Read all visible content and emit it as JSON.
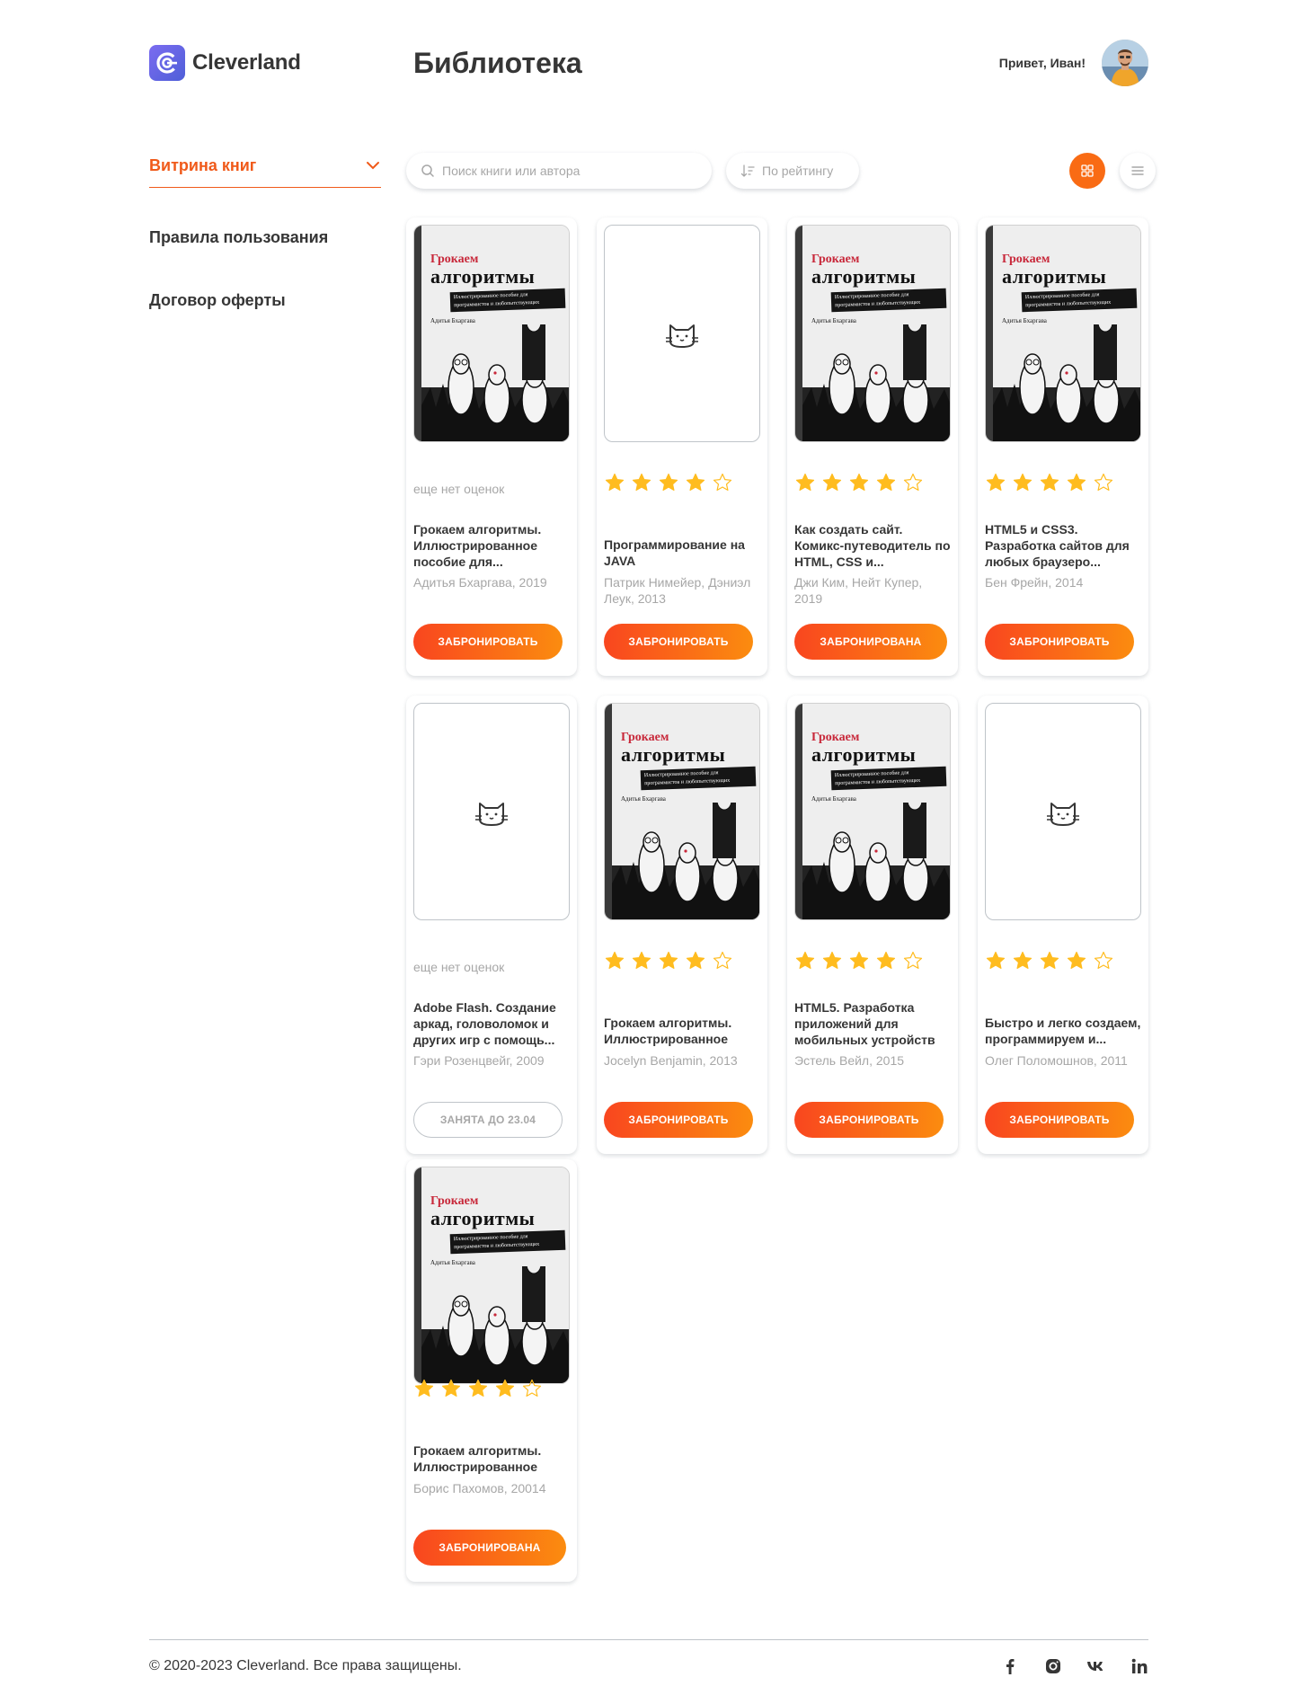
{
  "brand": {
    "name": "Cleverland",
    "accent": "#f96b14"
  },
  "header": {
    "title": "Библиотека",
    "greeting": "Привет, Иван!"
  },
  "sidebar": {
    "items": [
      {
        "label": "Витрина книг",
        "active": true
      },
      {
        "label": "Правила пользования",
        "active": false
      },
      {
        "label": "Договор оферты",
        "active": false
      }
    ]
  },
  "toolbar": {
    "search_placeholder": "Поиск книги или автора",
    "sort_label": "По рейтингу",
    "view_mode": "grid"
  },
  "cover_text": {
    "top": "Грокаем",
    "main": "алгоритмы",
    "sub": "Иллюстрированное пособие для программистов и любопытствующих",
    "author": "Адитья Бхаргава"
  },
  "books": [
    {
      "cover": "book",
      "rating": null,
      "no_rating_text": "еще нет оценок",
      "title": "Грокаем алгоритмы. Иллюстрированное пособие для...",
      "author": "Адитья Бхаргава, 2019",
      "button": "ЗАБРОНИРОВАТЬ",
      "state": "available"
    },
    {
      "cover": "empty",
      "rating": 4,
      "title": "Программирование на JAVA",
      "author": "Патрик Нимейер, Дэниэл Леук, 2013",
      "button": "ЗАБРОНИРОВАТЬ",
      "state": "available"
    },
    {
      "cover": "book",
      "rating": 4,
      "title": "Как создать сайт. Комикс-путеводитель по HTML, CSS и...",
      "author": "Джи Ким, Нейт Купер, 2019",
      "button": "ЗАБРОНИРОВАНА",
      "state": "booked"
    },
    {
      "cover": "book",
      "rating": 4,
      "title": "HTML5 и CSS3. Разработка сайтов для любых браузеро...",
      "author": "Бен Фрейн, 2014",
      "button": "ЗАБРОНИРОВАТЬ",
      "state": "available"
    },
    {
      "cover": "empty",
      "rating": null,
      "no_rating_text": "еще нет оценок",
      "title": "Adobe Flash. Создание аркад, головоломок и других игр с помощь...",
      "author": "Гэри Розенцвейг, 2009",
      "button": "ЗАНЯТА ДО 23.04",
      "state": "busy"
    },
    {
      "cover": "book",
      "rating": 4,
      "title": "Грокаем алгоритмы. Иллюстрированное",
      "author": "Jocelyn Benjamin, 2013",
      "button": "ЗАБРОНИРОВАТЬ",
      "state": "available"
    },
    {
      "cover": "book",
      "rating": 4,
      "title": "HTML5. Разработка приложений для мобильных устройств",
      "author": "Эстель Вейл, 2015",
      "button": "ЗАБРОНИРОВАТЬ",
      "state": "available"
    },
    {
      "cover": "empty",
      "rating": 4,
      "title": "Быстро и легко создаем, программируем и...",
      "author": "Олег Поломошнов, 2011",
      "button": "ЗАБРОНИРОВАТЬ",
      "state": "available"
    },
    {
      "cover": "book",
      "rating": 4,
      "title": "Грокаем алгоритмы. Иллюстрированное",
      "author": "Борис Пахомов, 20014",
      "button": "ЗАБРОНИРОВАНА",
      "state": "booked"
    }
  ],
  "footer": {
    "copyright": "© 2020-2023 Cleverland. Все права защищены.",
    "socials": [
      "facebook-icon",
      "instagram-icon",
      "vk-icon",
      "linkedin-icon"
    ]
  }
}
